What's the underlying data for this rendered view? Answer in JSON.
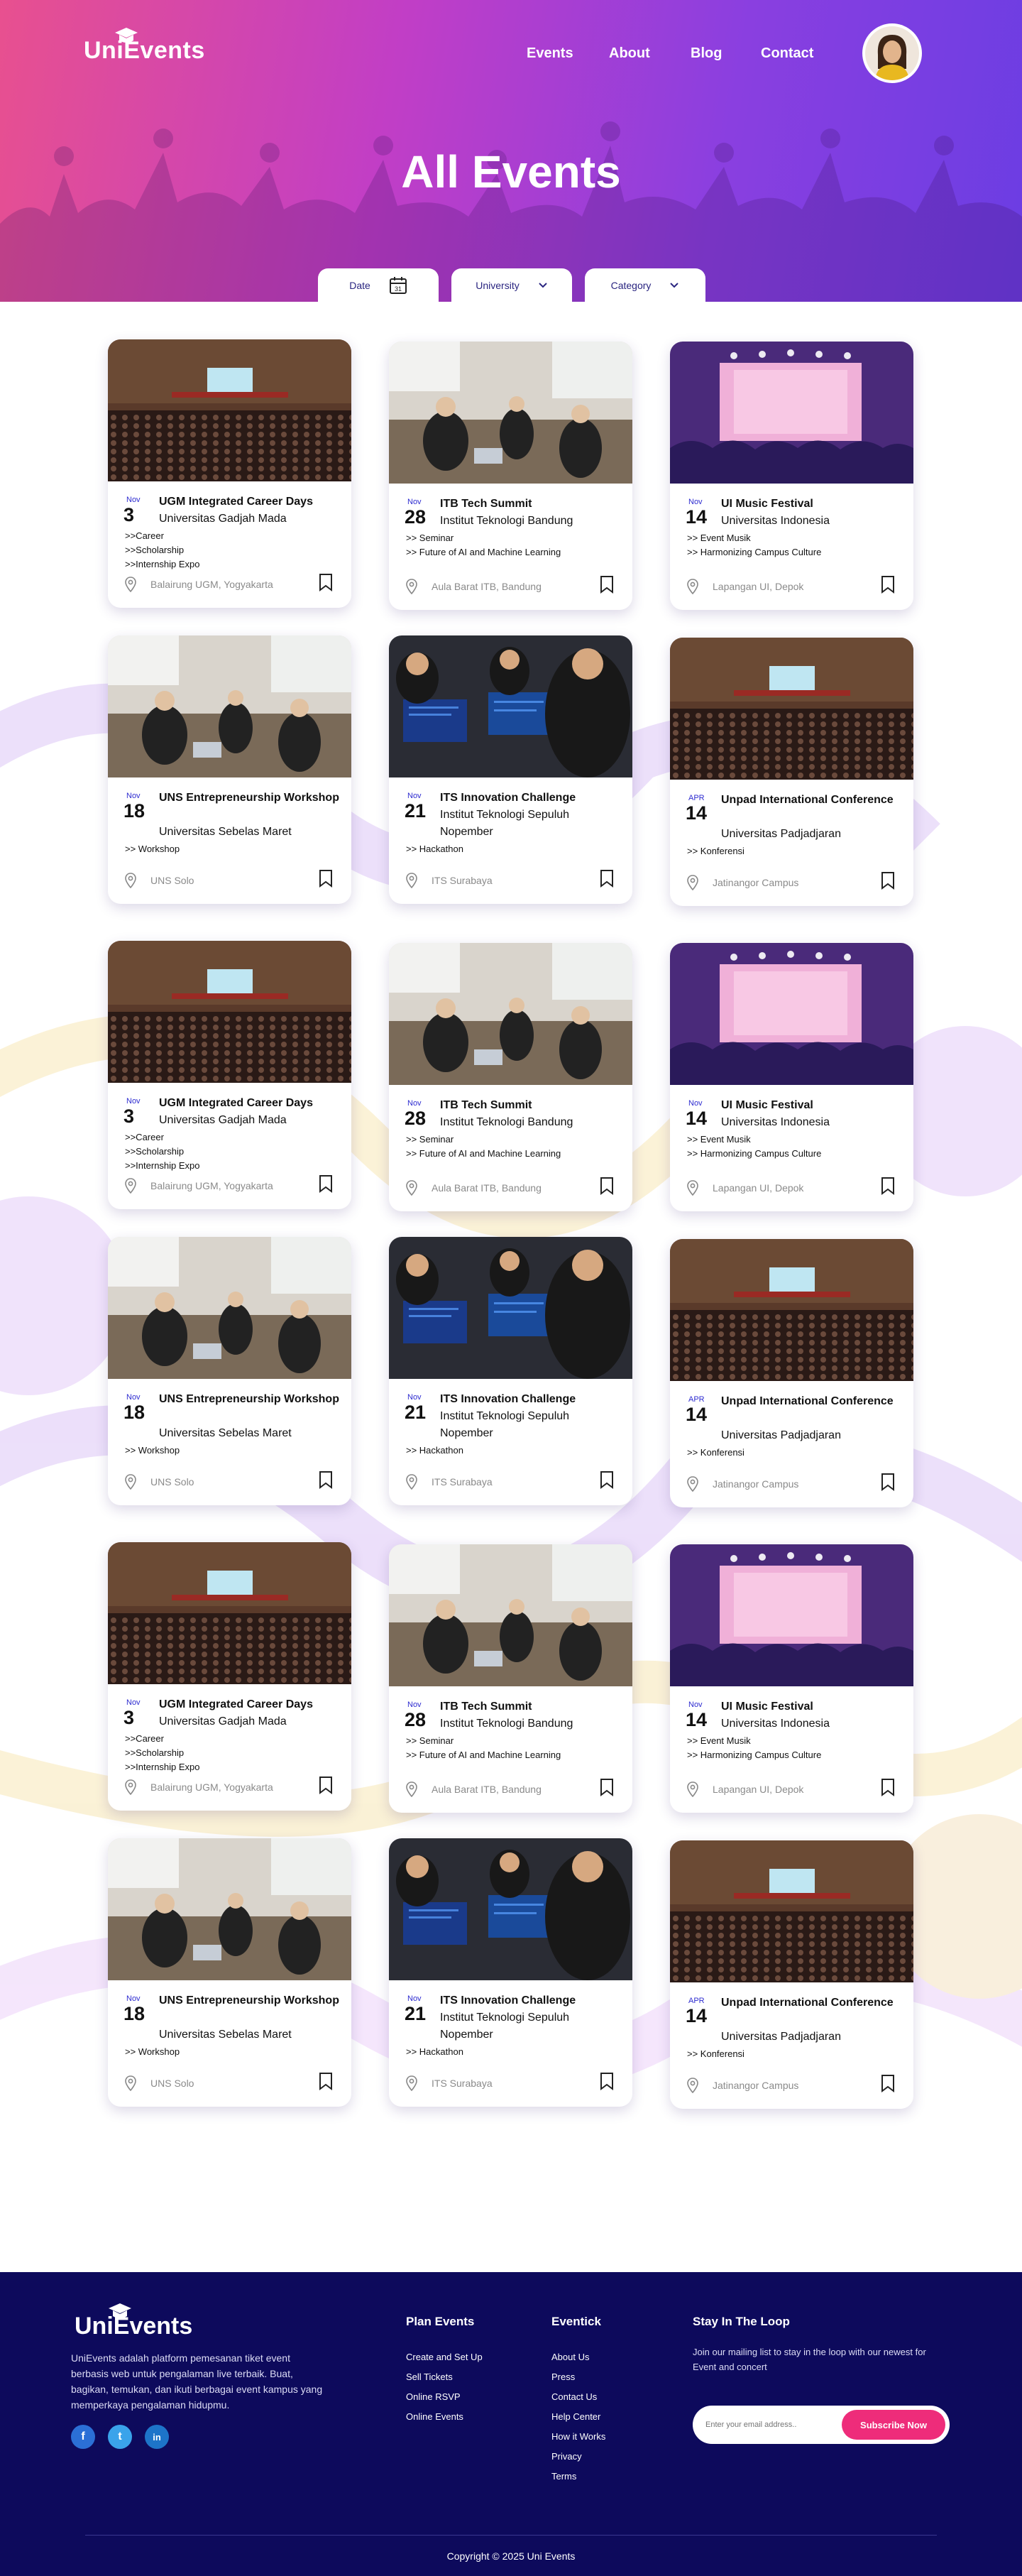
{
  "brand": {
    "logo": "UniEvents"
  },
  "nav": [
    "Events",
    "About",
    "Blog",
    "Contact"
  ],
  "hero": {
    "title": "All Events"
  },
  "filters": [
    {
      "label": "Date",
      "icon": "calendar-icon"
    },
    {
      "label": "University",
      "icon": "chevron-down-icon"
    },
    {
      "label": "Category",
      "icon": "chevron-down-icon"
    }
  ],
  "cards": [
    {
      "month": "Nov",
      "day": "3",
      "title": "UGM Integrated Career Days",
      "uni": "Universitas Gadjah Mada",
      "tags": [
        ">>Career",
        ">>Scholarship",
        ">>Internship Expo"
      ],
      "location": "Balairung UGM, Yogyakarta",
      "image": "auditorium"
    },
    {
      "month": "Nov",
      "day": "28",
      "title": "ITB Tech Summit",
      "uni": "Institut Teknologi Bandung",
      "tags": [
        ">> Seminar",
        ">> Future of AI and Machine Learning"
      ],
      "location": "Aula Barat ITB, Bandung",
      "image": "classroom"
    },
    {
      "month": "Nov",
      "day": "14",
      "title": "UI Music Festival",
      "uni": "Universitas Indonesia",
      "tags": [
        ">> Event Musik",
        ">> Harmonizing Campus Culture"
      ],
      "location": "Lapangan UI, Depok",
      "image": "concert"
    },
    {
      "month": "Nov",
      "day": "18",
      "title": "UNS Entrepreneurship Workshop",
      "uni": "Universitas Sebelas Maret",
      "tags": [
        ">> Workshop"
      ],
      "location": "UNS Solo",
      "image": "classroom"
    },
    {
      "month": "Nov",
      "day": "21",
      "title": "ITS Innovation Challenge",
      "uni": "Institut Teknologi Sepuluh Nopember",
      "tags": [
        ">> Hackathon"
      ],
      "location": "ITS Surabaya",
      "image": "hackathon"
    },
    {
      "month": "APR",
      "day": "14",
      "title": "Unpad International Conference",
      "uni": "Universitas Padjadjaran",
      "tags": [
        ">> Konferensi"
      ],
      "location": "Jatinangor Campus",
      "image": "auditorium"
    }
  ],
  "footer": {
    "logo": "UniEvents",
    "description": "UniEvents adalah platform pemesanan tiket event berbasis web untuk pengalaman live terbaik. Buat, bagikan, temukan, dan ikuti berbagai event kampus yang memperkaya pengalaman hidupmu.",
    "social": [
      {
        "icon": "facebook-icon",
        "glyph": "f"
      },
      {
        "icon": "twitter-icon",
        "glyph": "t"
      },
      {
        "icon": "linkedin-icon",
        "glyph": "in"
      }
    ],
    "plan_events": {
      "title": "Plan Events",
      "links": [
        "Create and Set Up",
        "Sell Tickets",
        "Online RSVP",
        "Online Events"
      ]
    },
    "eventick": {
      "title": "Eventick",
      "links": [
        "About Us",
        "Press",
        "Contact Us",
        "Help Center",
        "How it Works",
        "Privacy",
        "Terms"
      ]
    },
    "stay": {
      "title": "Stay In The Loop",
      "text": "Join our mailing list to stay in the loop with our newest for Event and concert",
      "placeholder": "Enter your email address..",
      "button": "Subscribe Now"
    },
    "copyright": "Copyright © 2025 Uni Events"
  }
}
